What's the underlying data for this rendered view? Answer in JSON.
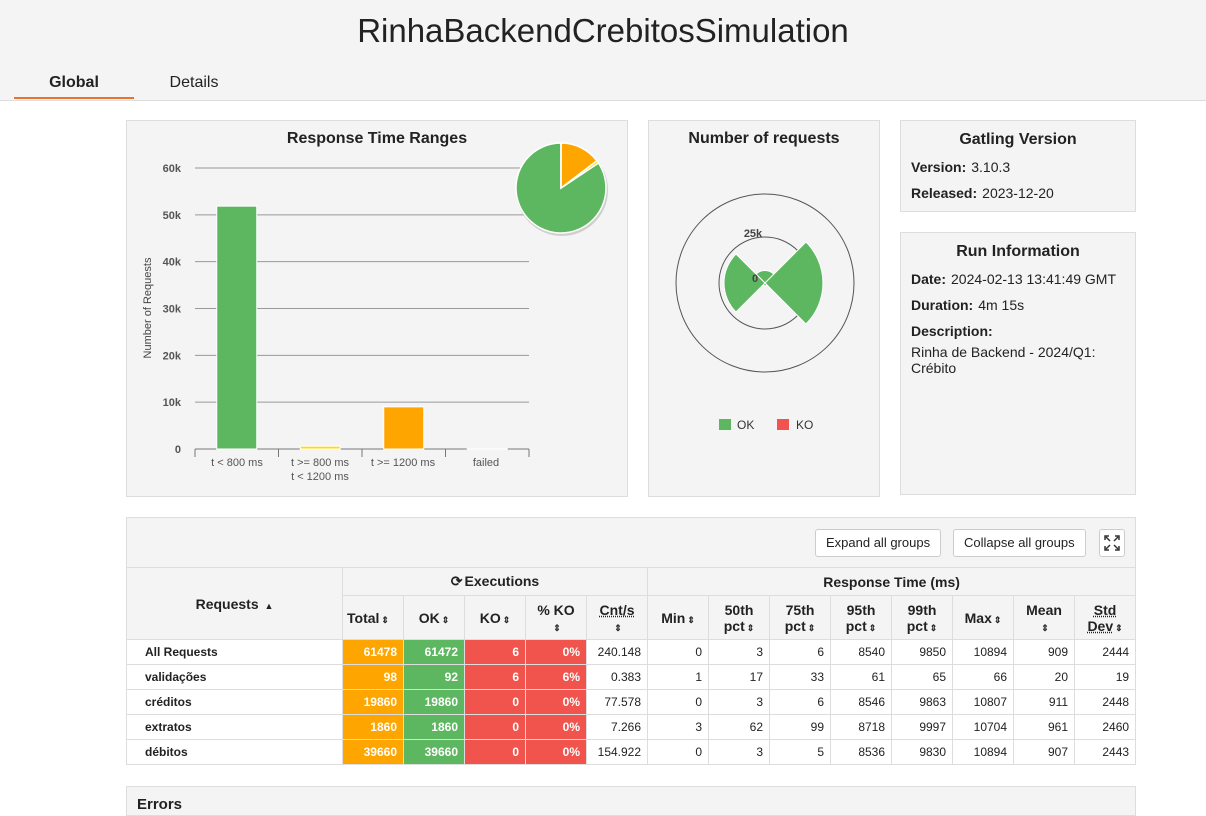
{
  "header": {
    "title": "RinhaBackendCrebitosSimulation"
  },
  "tabs": [
    {
      "label": "Global"
    },
    {
      "label": "Details"
    }
  ],
  "response_time_ranges": {
    "title": "Response Time Ranges",
    "ylabel": "Number of Requests",
    "yticks": [
      "0",
      "10k",
      "20k",
      "30k",
      "40k",
      "50k",
      "60k"
    ],
    "categories": [
      {
        "line1": "t < 800 ms",
        "line2": ""
      },
      {
        "line1": "t >= 800 ms",
        "line2": "t < 1200 ms"
      },
      {
        "line1": "t >= 1200 ms",
        "line2": ""
      },
      {
        "line1": "failed",
        "line2": ""
      }
    ]
  },
  "number_of_requests": {
    "title": "Number of requests",
    "tick_labels": [
      "25k",
      "0"
    ],
    "legend": [
      {
        "label": "OK",
        "color": "#5db760"
      },
      {
        "label": "KO",
        "color": "#f0544c"
      }
    ]
  },
  "gatling": {
    "title": "Gatling Version",
    "version_label": "Version:",
    "version": "3.10.3",
    "released_label": "Released:",
    "released": "2023-12-20"
  },
  "run_info": {
    "title": "Run Information",
    "date_label": "Date:",
    "date": "2024-02-13 13:41:49 GMT",
    "duration_label": "Duration:",
    "duration": "4m 15s",
    "description_label": "Description:",
    "description_line1": "Rinha de Backend - 2024/Q1:",
    "description_line2": "Crébito"
  },
  "toolbar": {
    "expand": "Expand all groups",
    "collapse": "Collapse all groups"
  },
  "table": {
    "requests_header": "Requests",
    "executions_header": "Executions",
    "response_time_header": "Response Time (ms)",
    "columns": {
      "total": "Total",
      "ok": "OK",
      "ko": "KO",
      "pct_ko": "% KO",
      "cnt_s": "Cnt/s",
      "min": "Min",
      "p50_a": "50th",
      "p50_b": "pct",
      "p75_a": "75th",
      "p75_b": "pct",
      "p95_a": "95th",
      "p95_b": "pct",
      "p99_a": "99th",
      "p99_b": "pct",
      "max": "Max",
      "mean": "Mean",
      "std_a": "Std",
      "std_b": "Dev"
    },
    "rows": [
      {
        "name": "All Requests",
        "total": "61478",
        "ok": "61472",
        "ko": "6",
        "pct_ko": "0%",
        "cnt": "240.148",
        "min": "0",
        "p50": "3",
        "p75": "6",
        "p95": "8540",
        "p99": "9850",
        "max": "10894",
        "mean": "909",
        "std": "2444"
      },
      {
        "name": "validações",
        "total": "98",
        "ok": "92",
        "ko": "6",
        "pct_ko": "6%",
        "cnt": "0.383",
        "min": "1",
        "p50": "17",
        "p75": "33",
        "p95": "61",
        "p99": "65",
        "max": "66",
        "mean": "20",
        "std": "19"
      },
      {
        "name": "créditos",
        "total": "19860",
        "ok": "19860",
        "ko": "0",
        "pct_ko": "0%",
        "cnt": "77.578",
        "min": "0",
        "p50": "3",
        "p75": "6",
        "p95": "8546",
        "p99": "9863",
        "max": "10807",
        "mean": "911",
        "std": "2448"
      },
      {
        "name": "extratos",
        "total": "1860",
        "ok": "1860",
        "ko": "0",
        "pct_ko": "0%",
        "cnt": "7.266",
        "min": "3",
        "p50": "62",
        "p75": "99",
        "p95": "8718",
        "p99": "9997",
        "max": "10704",
        "mean": "961",
        "std": "2460"
      },
      {
        "name": "débitos",
        "total": "39660",
        "ok": "39660",
        "ko": "0",
        "pct_ko": "0%",
        "cnt": "154.922",
        "min": "0",
        "p50": "3",
        "p75": "5",
        "p95": "8536",
        "p99": "9830",
        "max": "10894",
        "mean": "907",
        "std": "2443"
      }
    ]
  },
  "errors": {
    "title": "Errors"
  },
  "chart_data": [
    {
      "type": "bar",
      "title": "Response Time Ranges",
      "ylabel": "Number of Requests",
      "xlabel": "",
      "categories": [
        "t < 800 ms",
        "t >= 800 ms t < 1200 ms",
        "t >= 1200 ms",
        "failed"
      ],
      "values": [
        51850,
        600,
        9000,
        6
      ],
      "colors": [
        "#5db760",
        "#ffdd00",
        "#ffa500",
        "#f0544c"
      ],
      "ylim": [
        0,
        60000
      ],
      "grid": true
    },
    {
      "type": "pie",
      "categories": [
        "t < 800 ms",
        "t >= 800 ms t < 1200 ms",
        "t >= 1200 ms",
        "failed"
      ],
      "values": [
        51850,
        600,
        9000,
        6
      ],
      "colors": [
        "#5db760",
        "#ffdd00",
        "#ffa500",
        "#f0544c"
      ]
    },
    {
      "type": "pie",
      "title": "Number of requests",
      "categories": [
        "validações",
        "créditos",
        "extratos",
        "débitos"
      ],
      "series": [
        {
          "name": "OK",
          "values": [
            92,
            19860,
            1860,
            39660
          ]
        },
        {
          "name": "KO",
          "values": [
            6,
            0,
            0,
            0
          ]
        }
      ],
      "tick_labels": [
        "0",
        "25k"
      ]
    }
  ]
}
